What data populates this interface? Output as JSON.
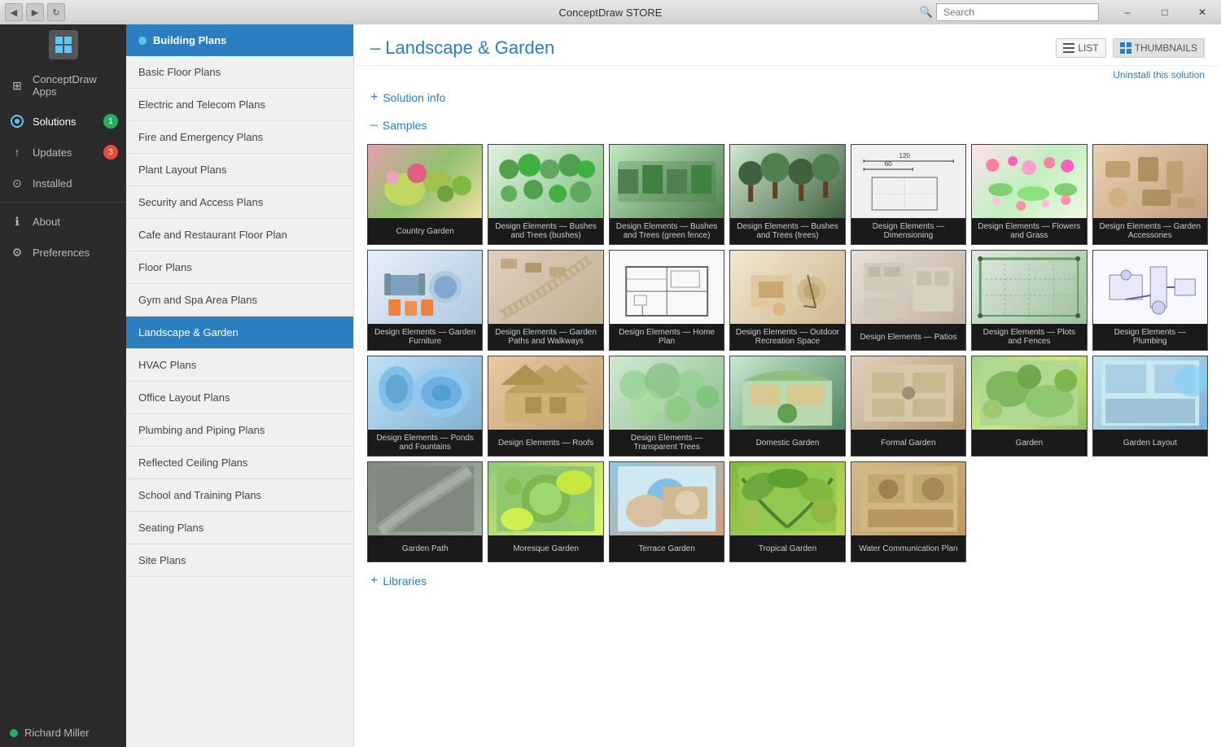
{
  "titlebar": {
    "title": "ConceptDraw STORE",
    "minimize": "–",
    "maximize": "□",
    "close": "✕"
  },
  "nav": {
    "back": "◀",
    "forward": "▶",
    "refresh": "↻"
  },
  "sidebar": {
    "logo_icon": "★",
    "items": [
      {
        "id": "apps",
        "label": "ConceptDraw Apps",
        "icon": "⊞",
        "badge": null
      },
      {
        "id": "solutions",
        "label": "Solutions",
        "icon": "◈",
        "badge": "1",
        "badge_type": "green",
        "active": true
      },
      {
        "id": "updates",
        "label": "Updates",
        "icon": "↑",
        "badge": "3",
        "badge_type": "red"
      },
      {
        "id": "installed",
        "label": "Installed",
        "icon": "⊙",
        "badge": null
      }
    ],
    "divider_items": [
      {
        "id": "about",
        "label": "About",
        "icon": "ℹ"
      },
      {
        "id": "preferences",
        "label": "Preferences",
        "icon": "⚙"
      }
    ],
    "user": {
      "name": "Richard Miller",
      "dot_color": "#27ae60"
    }
  },
  "menu": {
    "header": "Building Plans",
    "items": [
      {
        "id": "basic-floor",
        "label": "Basic Floor Plans"
      },
      {
        "id": "electric-telecom",
        "label": "Electric and Telecom Plans"
      },
      {
        "id": "fire-emergency",
        "label": "Fire and Emergency Plans"
      },
      {
        "id": "plant-layout",
        "label": "Plant Layout Plans"
      },
      {
        "id": "security-access",
        "label": "Security and Access Plans"
      },
      {
        "id": "cafe-restaurant",
        "label": "Cafe and Restaurant Floor Plan"
      },
      {
        "id": "floor-plans",
        "label": "Floor Plans"
      },
      {
        "id": "gym-spa",
        "label": "Gym and Spa Area Plans"
      },
      {
        "id": "landscape",
        "label": "Landscape & Garden",
        "active": true
      },
      {
        "id": "hvac",
        "label": "HVAC Plans"
      },
      {
        "id": "office-layout",
        "label": "Office Layout Plans"
      },
      {
        "id": "plumbing-piping",
        "label": "Plumbing and Piping Plans"
      },
      {
        "id": "reflected-ceiling",
        "label": "Reflected Ceiling Plans"
      },
      {
        "id": "school-training",
        "label": "School and Training Plans"
      },
      {
        "id": "seating",
        "label": "Seating Plans"
      },
      {
        "id": "site-plans",
        "label": "Site Plans"
      }
    ]
  },
  "content": {
    "title": "Landscape & Garden",
    "uninstall": "Uninstall this solution",
    "section_info_label": "Solution info",
    "section_info_sign": "+",
    "section_samples_label": "Samples",
    "section_samples_sign": "–",
    "section_libraries_label": "Libraries",
    "section_libraries_sign": "+",
    "view_list": "LIST",
    "view_thumbnails": "THUMBNAILS",
    "thumbnails": [
      {
        "id": "country-garden",
        "label": "Country Garden",
        "bg": "t-country"
      },
      {
        "id": "design-bushes-bushes",
        "label": "Design Elements — Bushes and Trees (bushes)",
        "bg": "t-bushes-bushes"
      },
      {
        "id": "design-bushes-green",
        "label": "Design Elements — Bushes and Trees (green fence)",
        "bg": "t-bushes-green"
      },
      {
        "id": "design-bushes-trees",
        "label": "Design Elements — Bushes and Trees (trees)",
        "bg": "t-bushes-trees"
      },
      {
        "id": "design-dimensioning",
        "label": "Design Elements — Dimensioning",
        "bg": "t-dimensioning"
      },
      {
        "id": "design-flowers",
        "label": "Design Elements — Flowers and Grass",
        "bg": "t-flowers"
      },
      {
        "id": "design-garden-acc",
        "label": "Design Elements — Garden Accessories",
        "bg": "t-garden-acc"
      },
      {
        "id": "design-furniture",
        "label": "Design Elements — Garden Furniture",
        "bg": "t-furniture"
      },
      {
        "id": "design-paths",
        "label": "Design Elements — Garden Paths and Walkways",
        "bg": "t-paths"
      },
      {
        "id": "design-homeplan",
        "label": "Design Elements — Home Plan",
        "bg": "t-homeplan"
      },
      {
        "id": "design-outdoor",
        "label": "Design Elements — Outdoor Recreation Space",
        "bg": "t-outdoor"
      },
      {
        "id": "design-patios",
        "label": "Design Elements — Patios",
        "bg": "t-patios"
      },
      {
        "id": "design-plots",
        "label": "Design Elements — Plots and Fences",
        "bg": "t-plots"
      },
      {
        "id": "design-plumbing",
        "label": "Design Elements — Plumbing",
        "bg": "t-plumbing"
      },
      {
        "id": "design-ponds",
        "label": "Design Elements — Ponds and Fountains",
        "bg": "t-ponds"
      },
      {
        "id": "design-roofs",
        "label": "Design Elements — Roofs",
        "bg": "t-roofs"
      },
      {
        "id": "design-transparent",
        "label": "Design Elements — Transparent Trees",
        "bg": "t-transparent"
      },
      {
        "id": "domestic-garden",
        "label": "Domestic Garden",
        "bg": "t-domestic"
      },
      {
        "id": "formal-garden",
        "label": "Formal Garden",
        "bg": "t-formal"
      },
      {
        "id": "garden",
        "label": "Garden",
        "bg": "t-garden"
      },
      {
        "id": "garden-layout",
        "label": "Garden Layout",
        "bg": "t-layout"
      },
      {
        "id": "garden-path",
        "label": "Garden Path",
        "bg": "t-path"
      },
      {
        "id": "moresque-garden",
        "label": "Moresque Garden",
        "bg": "t-moresque"
      },
      {
        "id": "terrace-garden",
        "label": "Terrace Garden",
        "bg": "t-terrace"
      },
      {
        "id": "tropical-garden",
        "label": "Tropical Garden",
        "bg": "t-tropical"
      },
      {
        "id": "water-communication",
        "label": "Water Communication Plan",
        "bg": "t-water"
      }
    ]
  },
  "search": {
    "placeholder": "Search"
  }
}
